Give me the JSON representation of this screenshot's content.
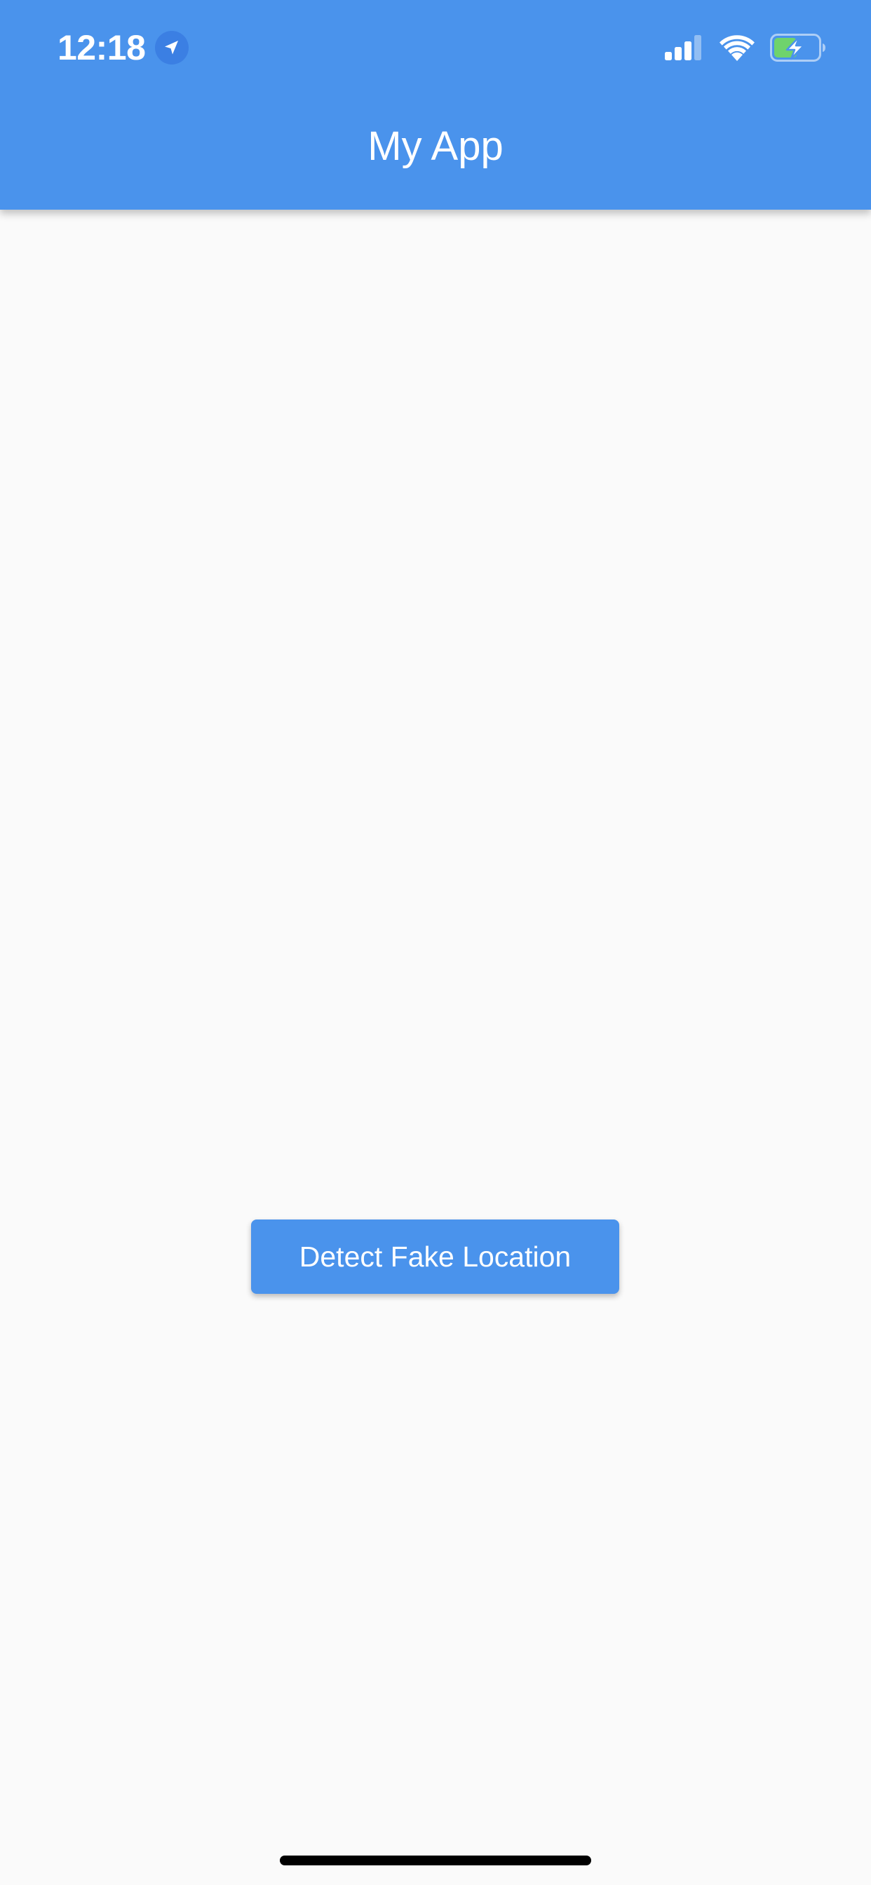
{
  "status_bar": {
    "time": "12:18",
    "location_icon": "location-arrow-icon",
    "signal_icon": "cellular-signal-icon",
    "wifi_icon": "wifi-icon",
    "battery_icon": "battery-charging-icon"
  },
  "app_bar": {
    "title": "My App"
  },
  "main": {
    "detect_button_label": "Detect Fake Location"
  },
  "colors": {
    "primary": "#4a93ec",
    "background": "#fafafa",
    "text_on_primary": "#ffffff",
    "battery_fill": "#6fd36c"
  }
}
